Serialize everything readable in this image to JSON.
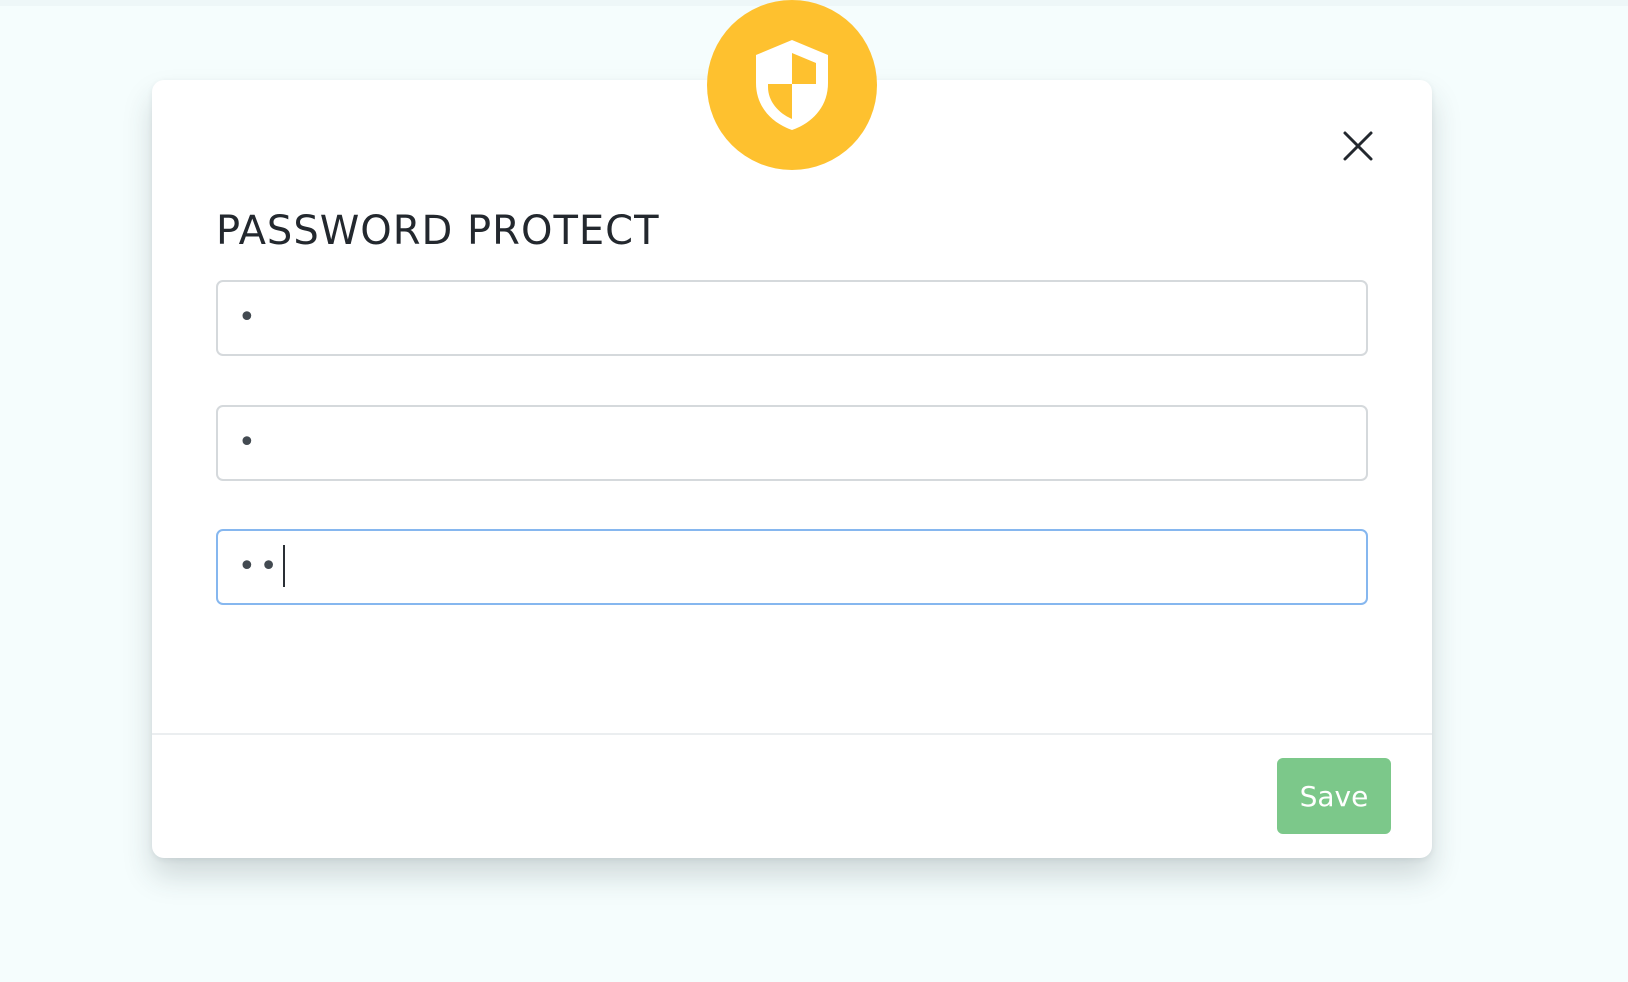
{
  "colors": {
    "badge": "#fec12f",
    "save_button": "#7cc88a",
    "focused_border": "#86b7ef",
    "background": "#f5fdfd"
  },
  "badge": {
    "icon": "shield-icon"
  },
  "close": {
    "icon": "close-icon"
  },
  "dialog": {
    "title": "PASSWORD PROTECT"
  },
  "fields": [
    {
      "name": "password",
      "masked_value": "•"
    },
    {
      "name": "confirm-password",
      "masked_value": "•"
    },
    {
      "name": "third-password",
      "masked_value": "••"
    }
  ],
  "footer": {
    "save_label": "Save"
  }
}
